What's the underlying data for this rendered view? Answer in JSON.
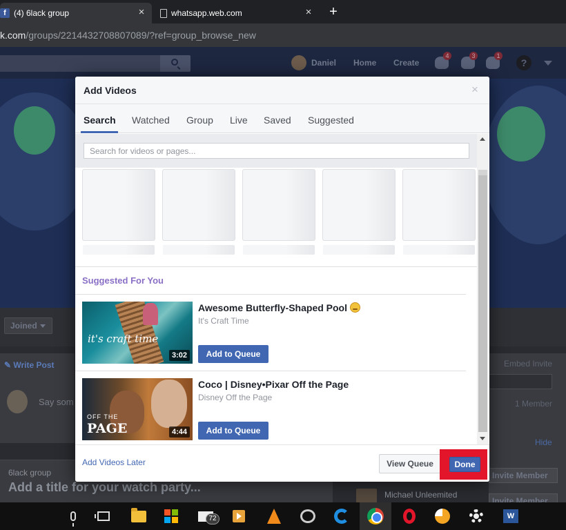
{
  "browser": {
    "tabs": [
      {
        "title": "(4) 6lack group",
        "favicon": "facebook-icon",
        "active": true
      },
      {
        "title": "whatsapp.web.com",
        "favicon": "page-icon",
        "active": false
      }
    ],
    "url_prefix": "k.com",
    "url_rest": "/groups/2214432708807089/?ref=group_browse_new"
  },
  "fb": {
    "user_name": "Daniel",
    "nav": [
      "Home",
      "Create"
    ],
    "badges": {
      "friends": "4",
      "messages": "3",
      "notifications": "1"
    },
    "help": "?",
    "joined_label": "Joined",
    "write_post": "Write Post",
    "say_something": "Say som",
    "watch_group": "6lack group",
    "watch_title": "Add a title for your watch party...",
    "embed_invite": "Embed Invite",
    "member_count": "1 Member",
    "hide": "Hide",
    "invite_member": "Invite Member",
    "member_name": "Michael Unleemited"
  },
  "modal": {
    "title": "Add Videos",
    "close": "×",
    "tabs": [
      "Search",
      "Watched",
      "Group",
      "Live",
      "Saved",
      "Suggested"
    ],
    "selected_tab": "Search",
    "search_placeholder": "Search for videos or pages...",
    "section_title": "Suggested For You",
    "videos": [
      {
        "title": "Awesome Butterfly-Shaped Pool",
        "emoji": "grinning-squinting-emoji",
        "channel": "It's Craft Time",
        "duration": "3:02",
        "thumb_text": "it's craft time",
        "button": "Add to Queue"
      },
      {
        "title": "Coco | Disney•Pixar Off the Page",
        "channel": "Disney Off the Page",
        "duration": "4:44",
        "thumb_text_small": "OFF THE",
        "thumb_text_big": "PAGE",
        "button": "Add to Queue"
      }
    ],
    "footer": {
      "later": "Add Videos Later",
      "view_queue": "View Queue",
      "done": "Done"
    }
  },
  "taskbar": {
    "mail_badge": "72",
    "word_letter": "W"
  },
  "colors": {
    "facebook_blue": "#4267b2",
    "highlight_red": "#e3152b",
    "section_purple": "#8a6fc6"
  }
}
